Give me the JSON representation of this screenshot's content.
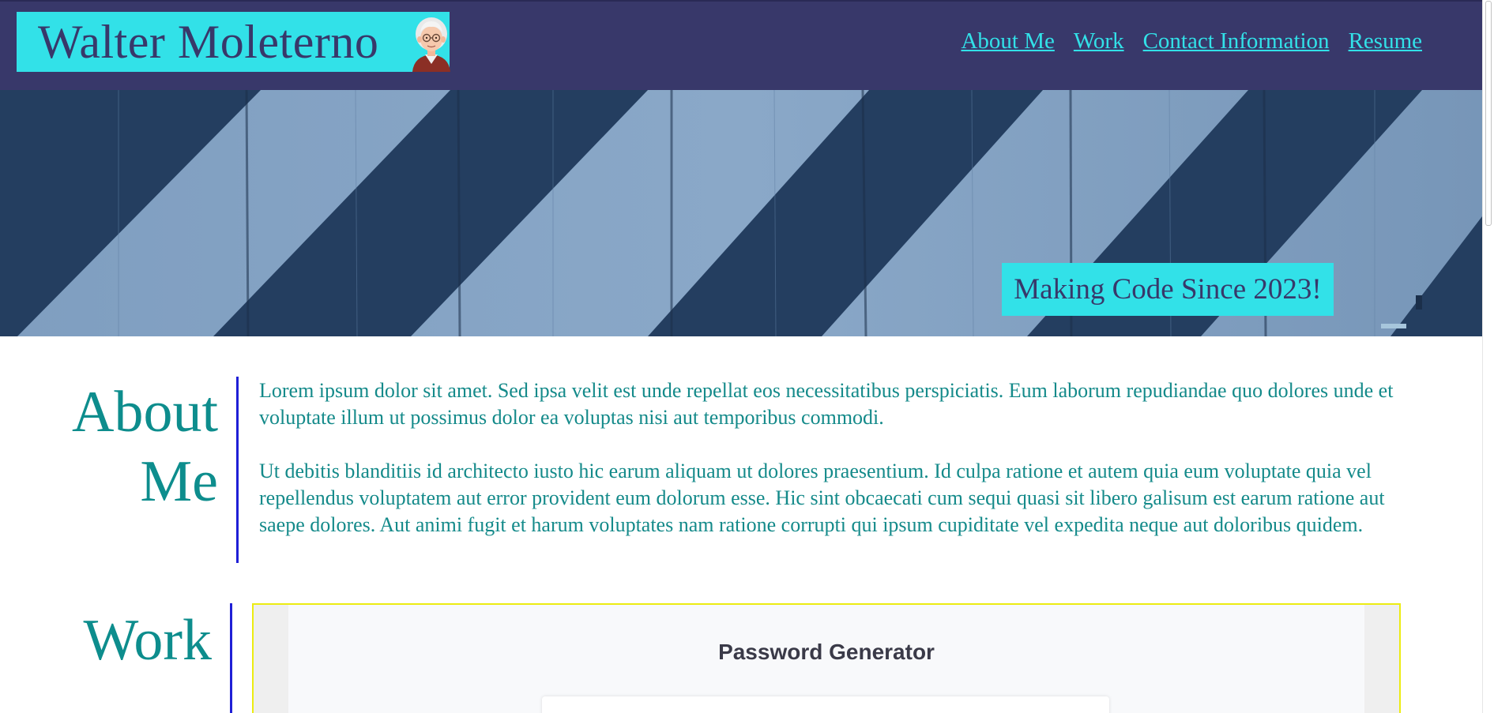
{
  "header": {
    "brand_name": "Walter Moleterno",
    "avatar_icon": "cartoon-old-man-avatar",
    "nav": [
      {
        "label": "About Me"
      },
      {
        "label": "Work"
      },
      {
        "label": "Contact Information"
      },
      {
        "label": "Resume"
      }
    ]
  },
  "hero": {
    "tagline": "Making Code Since 2023!"
  },
  "about": {
    "heading_line1": "About",
    "heading_line2": "Me",
    "paragraphs": [
      "Lorem ipsum dolor sit amet. Sed ipsa velit est unde repellat eos necessitatibus perspiciatis. Eum laborum repudiandae quo dolores unde et voluptate illum ut possimus dolor ea voluptas nisi aut temporibus commodi.",
      "Ut debitis blanditiis id architecto iusto hic earum aliquam ut dolores praesentium. Id culpa ratione et autem quia eum voluptate quia vel repellendus voluptatem aut error provident eum dolorum esse. Hic sint obcaecati cum sequi quasi sit libero galisum est earum ratione aut saepe dolores. Aut animi fugit et harum voluptates nam ratione corrupti qui ipsum cupiditate vel expedita neque aut doloribus quidem."
    ]
  },
  "work": {
    "heading": "Work",
    "project_title": "Password Generator"
  },
  "colors": {
    "header_bg": "#38386a",
    "accent_cyan": "#32e1e8",
    "heading_teal": "#0d8d8d",
    "divider_blue": "#1f1fd6",
    "frame_yellow": "#ecec12"
  }
}
